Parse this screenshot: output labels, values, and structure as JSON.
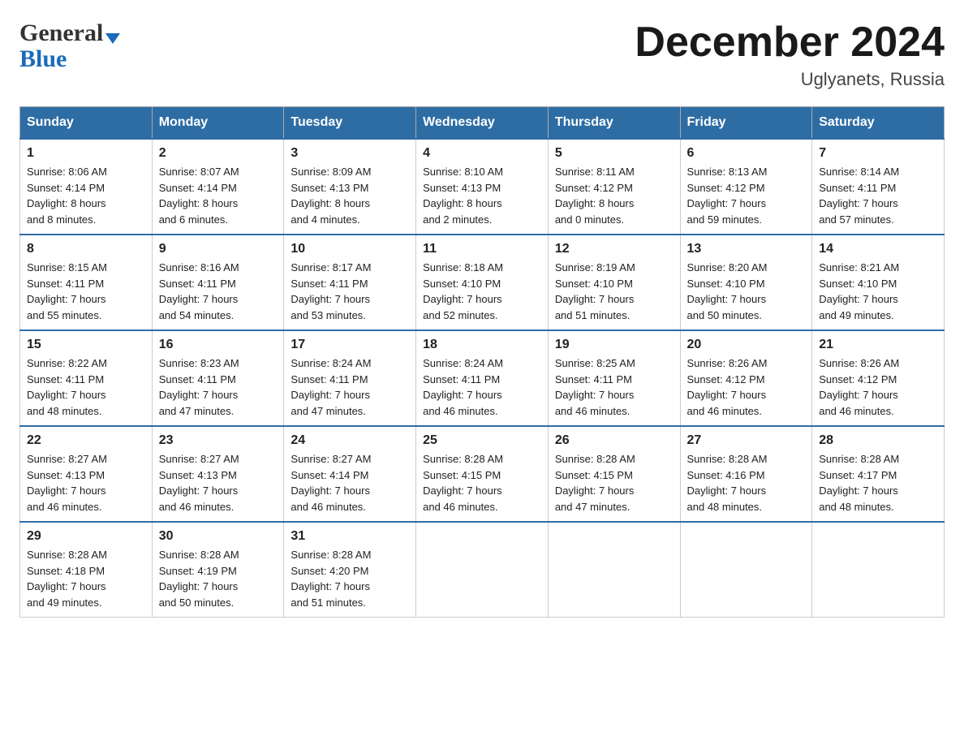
{
  "header": {
    "logo": {
      "general": "General",
      "blue": "Blue",
      "arrow_char": "▶"
    },
    "title": "December 2024",
    "location": "Uglyanets, Russia"
  },
  "calendar": {
    "days_of_week": [
      "Sunday",
      "Monday",
      "Tuesday",
      "Wednesday",
      "Thursday",
      "Friday",
      "Saturday"
    ],
    "weeks": [
      [
        {
          "day": "1",
          "sunrise": "Sunrise: 8:06 AM",
          "sunset": "Sunset: 4:14 PM",
          "daylight": "Daylight: 8 hours",
          "minutes": "and 8 minutes."
        },
        {
          "day": "2",
          "sunrise": "Sunrise: 8:07 AM",
          "sunset": "Sunset: 4:14 PM",
          "daylight": "Daylight: 8 hours",
          "minutes": "and 6 minutes."
        },
        {
          "day": "3",
          "sunrise": "Sunrise: 8:09 AM",
          "sunset": "Sunset: 4:13 PM",
          "daylight": "Daylight: 8 hours",
          "minutes": "and 4 minutes."
        },
        {
          "day": "4",
          "sunrise": "Sunrise: 8:10 AM",
          "sunset": "Sunset: 4:13 PM",
          "daylight": "Daylight: 8 hours",
          "minutes": "and 2 minutes."
        },
        {
          "day": "5",
          "sunrise": "Sunrise: 8:11 AM",
          "sunset": "Sunset: 4:12 PM",
          "daylight": "Daylight: 8 hours",
          "minutes": "and 0 minutes."
        },
        {
          "day": "6",
          "sunrise": "Sunrise: 8:13 AM",
          "sunset": "Sunset: 4:12 PM",
          "daylight": "Daylight: 7 hours",
          "minutes": "and 59 minutes."
        },
        {
          "day": "7",
          "sunrise": "Sunrise: 8:14 AM",
          "sunset": "Sunset: 4:11 PM",
          "daylight": "Daylight: 7 hours",
          "minutes": "and 57 minutes."
        }
      ],
      [
        {
          "day": "8",
          "sunrise": "Sunrise: 8:15 AM",
          "sunset": "Sunset: 4:11 PM",
          "daylight": "Daylight: 7 hours",
          "minutes": "and 55 minutes."
        },
        {
          "day": "9",
          "sunrise": "Sunrise: 8:16 AM",
          "sunset": "Sunset: 4:11 PM",
          "daylight": "Daylight: 7 hours",
          "minutes": "and 54 minutes."
        },
        {
          "day": "10",
          "sunrise": "Sunrise: 8:17 AM",
          "sunset": "Sunset: 4:11 PM",
          "daylight": "Daylight: 7 hours",
          "minutes": "and 53 minutes."
        },
        {
          "day": "11",
          "sunrise": "Sunrise: 8:18 AM",
          "sunset": "Sunset: 4:10 PM",
          "daylight": "Daylight: 7 hours",
          "minutes": "and 52 minutes."
        },
        {
          "day": "12",
          "sunrise": "Sunrise: 8:19 AM",
          "sunset": "Sunset: 4:10 PM",
          "daylight": "Daylight: 7 hours",
          "minutes": "and 51 minutes."
        },
        {
          "day": "13",
          "sunrise": "Sunrise: 8:20 AM",
          "sunset": "Sunset: 4:10 PM",
          "daylight": "Daylight: 7 hours",
          "minutes": "and 50 minutes."
        },
        {
          "day": "14",
          "sunrise": "Sunrise: 8:21 AM",
          "sunset": "Sunset: 4:10 PM",
          "daylight": "Daylight: 7 hours",
          "minutes": "and 49 minutes."
        }
      ],
      [
        {
          "day": "15",
          "sunrise": "Sunrise: 8:22 AM",
          "sunset": "Sunset: 4:11 PM",
          "daylight": "Daylight: 7 hours",
          "minutes": "and 48 minutes."
        },
        {
          "day": "16",
          "sunrise": "Sunrise: 8:23 AM",
          "sunset": "Sunset: 4:11 PM",
          "daylight": "Daylight: 7 hours",
          "minutes": "and 47 minutes."
        },
        {
          "day": "17",
          "sunrise": "Sunrise: 8:24 AM",
          "sunset": "Sunset: 4:11 PM",
          "daylight": "Daylight: 7 hours",
          "minutes": "and 47 minutes."
        },
        {
          "day": "18",
          "sunrise": "Sunrise: 8:24 AM",
          "sunset": "Sunset: 4:11 PM",
          "daylight": "Daylight: 7 hours",
          "minutes": "and 46 minutes."
        },
        {
          "day": "19",
          "sunrise": "Sunrise: 8:25 AM",
          "sunset": "Sunset: 4:11 PM",
          "daylight": "Daylight: 7 hours",
          "minutes": "and 46 minutes."
        },
        {
          "day": "20",
          "sunrise": "Sunrise: 8:26 AM",
          "sunset": "Sunset: 4:12 PM",
          "daylight": "Daylight: 7 hours",
          "minutes": "and 46 minutes."
        },
        {
          "day": "21",
          "sunrise": "Sunrise: 8:26 AM",
          "sunset": "Sunset: 4:12 PM",
          "daylight": "Daylight: 7 hours",
          "minutes": "and 46 minutes."
        }
      ],
      [
        {
          "day": "22",
          "sunrise": "Sunrise: 8:27 AM",
          "sunset": "Sunset: 4:13 PM",
          "daylight": "Daylight: 7 hours",
          "minutes": "and 46 minutes."
        },
        {
          "day": "23",
          "sunrise": "Sunrise: 8:27 AM",
          "sunset": "Sunset: 4:13 PM",
          "daylight": "Daylight: 7 hours",
          "minutes": "and 46 minutes."
        },
        {
          "day": "24",
          "sunrise": "Sunrise: 8:27 AM",
          "sunset": "Sunset: 4:14 PM",
          "daylight": "Daylight: 7 hours",
          "minutes": "and 46 minutes."
        },
        {
          "day": "25",
          "sunrise": "Sunrise: 8:28 AM",
          "sunset": "Sunset: 4:15 PM",
          "daylight": "Daylight: 7 hours",
          "minutes": "and 46 minutes."
        },
        {
          "day": "26",
          "sunrise": "Sunrise: 8:28 AM",
          "sunset": "Sunset: 4:15 PM",
          "daylight": "Daylight: 7 hours",
          "minutes": "and 47 minutes."
        },
        {
          "day": "27",
          "sunrise": "Sunrise: 8:28 AM",
          "sunset": "Sunset: 4:16 PM",
          "daylight": "Daylight: 7 hours",
          "minutes": "and 48 minutes."
        },
        {
          "day": "28",
          "sunrise": "Sunrise: 8:28 AM",
          "sunset": "Sunset: 4:17 PM",
          "daylight": "Daylight: 7 hours",
          "minutes": "and 48 minutes."
        }
      ],
      [
        {
          "day": "29",
          "sunrise": "Sunrise: 8:28 AM",
          "sunset": "Sunset: 4:18 PM",
          "daylight": "Daylight: 7 hours",
          "minutes": "and 49 minutes."
        },
        {
          "day": "30",
          "sunrise": "Sunrise: 8:28 AM",
          "sunset": "Sunset: 4:19 PM",
          "daylight": "Daylight: 7 hours",
          "minutes": "and 50 minutes."
        },
        {
          "day": "31",
          "sunrise": "Sunrise: 8:28 AM",
          "sunset": "Sunset: 4:20 PM",
          "daylight": "Daylight: 7 hours",
          "minutes": "and 51 minutes."
        },
        null,
        null,
        null,
        null
      ]
    ]
  }
}
